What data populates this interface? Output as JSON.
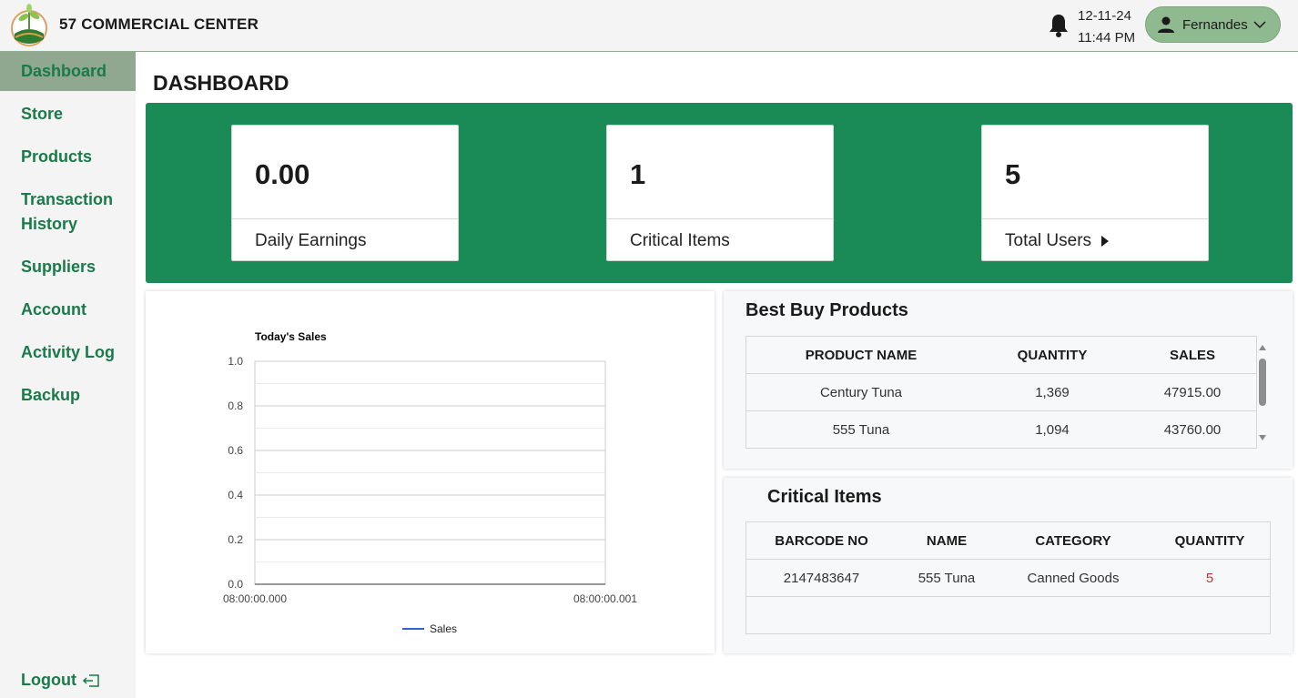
{
  "header": {
    "brand": "57 COMMERCIAL CENTER",
    "date": "12-11-24",
    "time": "11:44 PM",
    "user": "Fernandes",
    "icons": [
      "logo",
      "bell-icon",
      "user-icon",
      "chevron-down-icon"
    ]
  },
  "sidebar": {
    "items": [
      {
        "label": "Dashboard"
      },
      {
        "label": "Store"
      },
      {
        "label": "Products"
      },
      {
        "label": "Transaction History"
      },
      {
        "label": "Suppliers"
      },
      {
        "label": "Account"
      },
      {
        "label": "Activity Log"
      },
      {
        "label": "Backup"
      }
    ],
    "active": "Dashboard",
    "logout": "Logout"
  },
  "page": {
    "title": "DASHBOARD"
  },
  "stats": [
    {
      "value": "0.00",
      "label": "Daily Earnings"
    },
    {
      "value": "1",
      "label": "Critical Items"
    },
    {
      "value": "5",
      "label": "Total Users"
    }
  ],
  "colors": {
    "accent": "#1a8a56",
    "nav_text": "#1a7a4a",
    "active_nav": "#8fa88f",
    "user_button": "#8fb98f",
    "series": "#3366cc",
    "critical_qty": "#c0392b"
  },
  "chart_data": {
    "type": "line",
    "title": "Today's Sales",
    "x": [
      "08:00:00.000",
      "08:00:00.001"
    ],
    "series": [
      {
        "name": "Sales",
        "values": []
      }
    ],
    "y_ticks": [
      "1.0",
      "0.8",
      "0.6",
      "0.4",
      "0.2",
      "0.0"
    ],
    "ylim": [
      0,
      1
    ],
    "grid": true,
    "legend": "bottom"
  },
  "best_buy": {
    "title": "Best Buy Products",
    "headers": [
      "PRODUCT NAME",
      "QUANTITY",
      "SALES"
    ],
    "rows": [
      [
        "Century Tuna",
        "1,369",
        "47915.00"
      ],
      [
        "555 Tuna",
        "1,094",
        "43760.00"
      ]
    ]
  },
  "critical": {
    "title": "Critical Items",
    "headers": [
      "BARCODE NO",
      "NAME",
      "CATEGORY",
      "QUANTITY"
    ],
    "rows": [
      [
        "2147483647",
        "555 Tuna",
        "Canned Goods",
        "5"
      ]
    ]
  }
}
